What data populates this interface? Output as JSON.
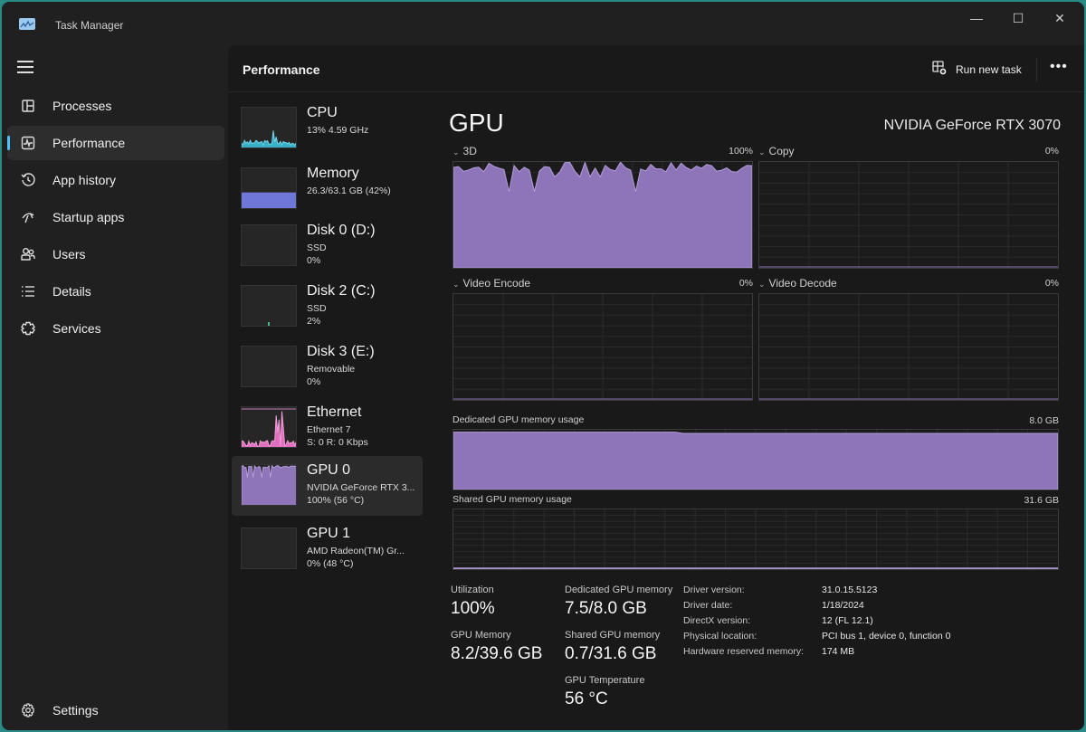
{
  "window": {
    "title": "Task Manager",
    "controls": {
      "minimize": "—",
      "maximize": "☐",
      "close": "✕"
    }
  },
  "sidebar": {
    "items": [
      {
        "label": "Processes",
        "icon": "processes-icon"
      },
      {
        "label": "Performance",
        "icon": "performance-icon",
        "active": true
      },
      {
        "label": "App history",
        "icon": "app-history-icon"
      },
      {
        "label": "Startup apps",
        "icon": "startup-apps-icon"
      },
      {
        "label": "Users",
        "icon": "users-icon"
      },
      {
        "label": "Details",
        "icon": "details-icon"
      },
      {
        "label": "Services",
        "icon": "services-icon"
      }
    ],
    "settings_label": "Settings"
  },
  "header": {
    "title": "Performance",
    "run_new_task": "Run new task",
    "more": "•••"
  },
  "devices": [
    {
      "name": "CPU",
      "sub1": "13%  4.59 GHz",
      "sub2": "",
      "color": "#3ab0c8"
    },
    {
      "name": "Memory",
      "sub1": "26.3/63.1 GB (42%)",
      "sub2": "",
      "color": "#6f78d8",
      "usage": 0.42
    },
    {
      "name": "Disk 0 (D:)",
      "sub1": "SSD",
      "sub2": "0%",
      "color": "#4fb38a"
    },
    {
      "name": "Disk 2 (C:)",
      "sub1": "SSD",
      "sub2": "2%",
      "color": "#4fb38a"
    },
    {
      "name": "Disk 3 (E:)",
      "sub1": "Removable",
      "sub2": "0%",
      "color": "#4fb38a"
    },
    {
      "name": "Ethernet",
      "sub1": "Ethernet 7",
      "sub2": "S: 0 R: 0 Kbps",
      "color": "#e06fbf"
    },
    {
      "name": "GPU 0",
      "sub1": "NVIDIA GeForce RTX 3...",
      "sub2": "100%  (56 °C)",
      "color": "#8e74b8",
      "active": true
    },
    {
      "name": "GPU 1",
      "sub1": "AMD Radeon(TM) Gr...",
      "sub2": "0%  (48 °C)",
      "color": "#8e74b8"
    }
  ],
  "gpu": {
    "title": "GPU",
    "model": "NVIDIA GeForce RTX 3070",
    "accent": "#8e74b8",
    "engines": [
      {
        "label": "3D",
        "value": "100%"
      },
      {
        "label": "Copy",
        "value": "0%"
      },
      {
        "label": "Video Encode",
        "value": "0%"
      },
      {
        "label": "Video Decode",
        "value": "0%"
      }
    ],
    "dedicated": {
      "label": "Dedicated GPU memory usage",
      "max": "8.0 GB",
      "usage": 0.94
    },
    "shared": {
      "label": "Shared GPU memory usage",
      "max": "31.6 GB",
      "usage": 0.02
    },
    "stats": {
      "utilization_label": "Utilization",
      "utilization": "100%",
      "gpu_memory_label": "GPU Memory",
      "gpu_memory": "8.2/39.6 GB",
      "dedicated_label": "Dedicated GPU memory",
      "dedicated": "7.5/8.0 GB",
      "shared_label": "Shared GPU memory",
      "shared": "0.7/31.6 GB",
      "temp_label": "GPU Temperature",
      "temp": "56 °C"
    },
    "details": [
      {
        "k": "Driver version:",
        "v": "31.0.15.5123"
      },
      {
        "k": "Driver date:",
        "v": "1/18/2024"
      },
      {
        "k": "DirectX version:",
        "v": "12 (FL 12.1)"
      },
      {
        "k": "Physical location:",
        "v": "PCI bus 1, device 0, function 0"
      },
      {
        "k": "Hardware reserved memory:",
        "v": "174 MB"
      }
    ]
  }
}
